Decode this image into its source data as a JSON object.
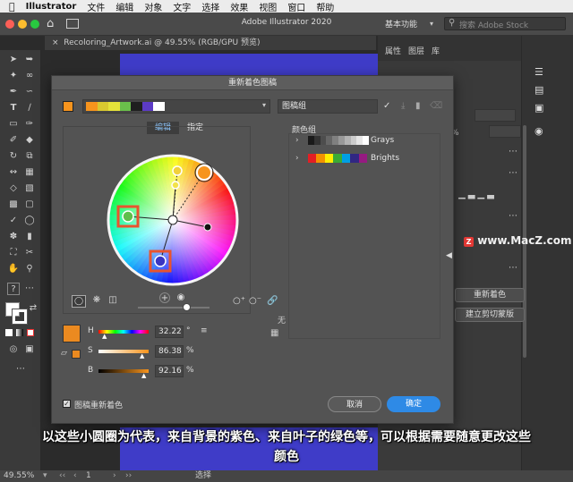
{
  "menubar": {
    "app_name": "Illustrator",
    "items": [
      "文件",
      "编辑",
      "对象",
      "文字",
      "选择",
      "效果",
      "视图",
      "窗口",
      "帮助"
    ]
  },
  "titlebar": {
    "title": "Adobe Illustrator 2020",
    "workspace": "基本功能",
    "search_placeholder": "搜索 Adobe Stock"
  },
  "document_tab": {
    "label": "Recoloring_Artwork.ai @ 49.55% (RGB/GPU 预览)"
  },
  "right_panel": {
    "tabs": [
      "属性",
      "图层",
      "库"
    ],
    "percent": "%",
    "recolor_button": "重新着色",
    "clipmask_button": "建立剪切蒙版"
  },
  "watermark": "www.MacZ.com",
  "dialog": {
    "title": "重新着色图稿",
    "group_name_field": "图稿组",
    "tabs": [
      "编辑",
      "指定"
    ],
    "color_groups_label": "颜色组",
    "color_groups": [
      {
        "name": "Grays",
        "colors": [
          "#1a1a1a",
          "#333333",
          "#4d4d4d",
          "#666666",
          "#808080",
          "#999999",
          "#b3b3b3",
          "#cccccc",
          "#e6e6e6",
          "#ffffff"
        ]
      },
      {
        "name": "Brights",
        "colors": [
          "#e31e24",
          "#f39200",
          "#ffed00",
          "#3aaa35",
          "#009fe3",
          "#312783",
          "#951b81"
        ]
      }
    ],
    "current_swatches": [
      "#f7941d",
      "#d9c830",
      "#e5e23a",
      "#6abf4b",
      "#1f1f1f",
      "#5c3bc6",
      "#ffffff"
    ],
    "hsb": {
      "h_label": "H",
      "h_value": "32.22",
      "h_unit": "°",
      "s_label": "S",
      "s_value": "86.38",
      "s_unit": "%",
      "b_label": "B",
      "b_value": "92.16",
      "b_unit": "%"
    },
    "base_color": "#eb8a20",
    "no_label": "无",
    "recolor_checkbox_label": "图稿重新着色",
    "recolor_checked": true,
    "cancel_button": "取消",
    "ok_button": "确定"
  },
  "caption": {
    "line1": "以这些小圆圈为代表，来自背景的紫色、来自叶子的绿色等，可以根据需要随意更改这些",
    "line2": "颜色"
  },
  "statusbar": {
    "zoom": "49.55%",
    "page": "1",
    "mode": "选择"
  }
}
